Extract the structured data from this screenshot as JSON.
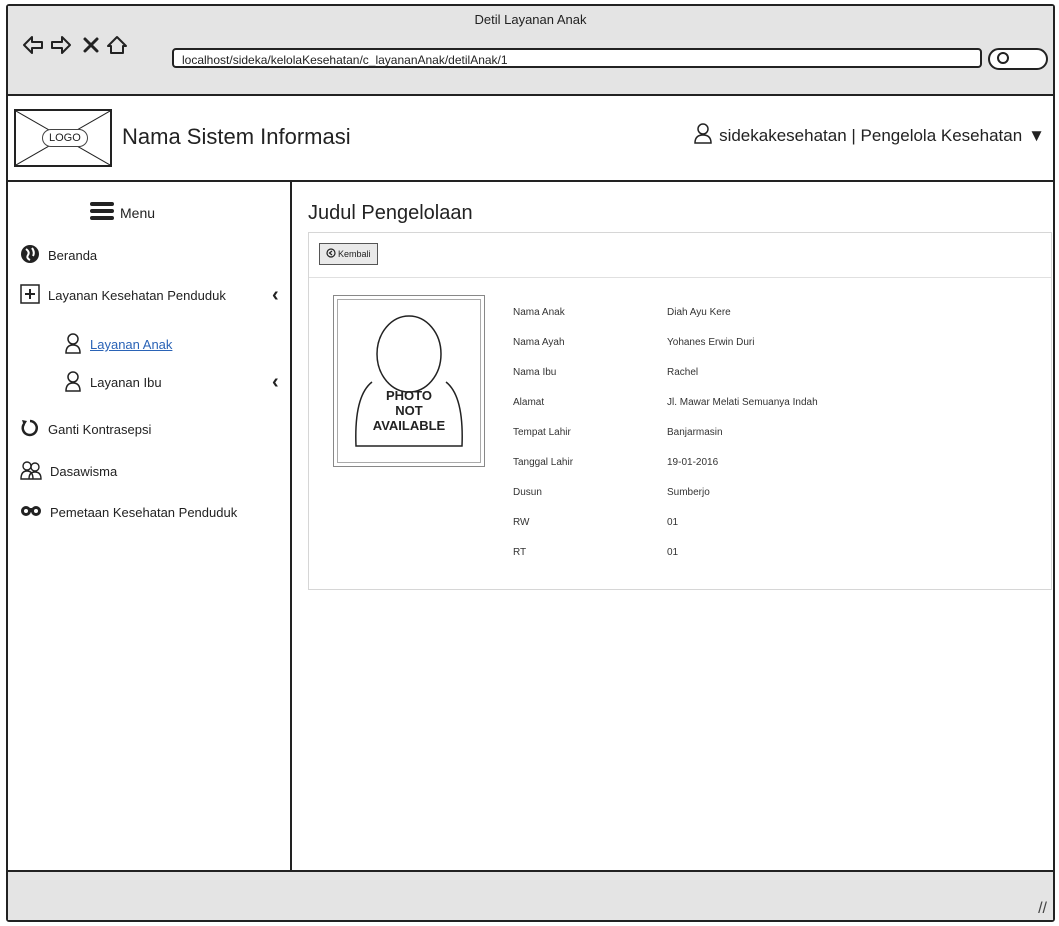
{
  "window": {
    "title": "Detil Layanan Anak",
    "url": "localhost/sideka/kelolaKesehatan/c_layananAnak/detilAnak/1"
  },
  "header": {
    "logo_text": "LOGO",
    "app_name": "Nama Sistem Informasi",
    "user_label": "sidekakesehatan | Pengelola Kesehatan"
  },
  "sidebar": {
    "menu_label": "Menu",
    "items": [
      {
        "label": "Beranda",
        "icon": "globe-icon"
      },
      {
        "label": "Layanan Kesehatan Penduduk",
        "icon": "plus-box-icon"
      },
      {
        "label": "Layanan Anak",
        "icon": "user-icon"
      },
      {
        "label": "Layanan Ibu",
        "icon": "user-icon"
      },
      {
        "label": "Ganti Kontrasepsi",
        "icon": "refresh-icon"
      },
      {
        "label": "Dasawisma",
        "icon": "group-icon"
      },
      {
        "label": "Pemetaan Kesehatan Penduduk",
        "icon": "binoculars-icon"
      }
    ]
  },
  "main": {
    "title": "Judul Pengelolaan",
    "back_button": "Kembali",
    "photo_text": [
      "PHOTO",
      "NOT",
      "AVAILABLE"
    ],
    "details": [
      {
        "label": "Nama Anak",
        "value": "Diah Ayu Kere"
      },
      {
        "label": "Nama Ayah",
        "value": "Yohanes Erwin Duri"
      },
      {
        "label": "Nama Ibu",
        "value": "Rachel"
      },
      {
        "label": "Alamat",
        "value": "Jl. Mawar Melati Semuanya Indah"
      },
      {
        "label": "Tempat Lahir",
        "value": "Banjarmasin"
      },
      {
        "label": "Tanggal Lahir",
        "value": "19-01-2016"
      },
      {
        "label": "Dusun",
        "value": "Sumberjo"
      },
      {
        "label": "RW",
        "value": "01"
      },
      {
        "label": "RT",
        "value": "01"
      }
    ]
  },
  "colors": {
    "chrome_bg": "#e4e4e4",
    "link_active": "#2a63b6",
    "border": "#222222"
  }
}
